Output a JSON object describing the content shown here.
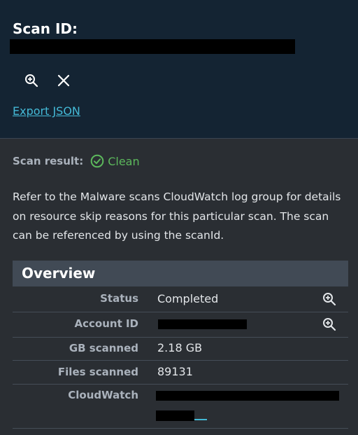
{
  "header": {
    "title": "Scan ID:",
    "export_label": "Export JSON",
    "zoom_icon": "zoom-in-icon",
    "close_icon": "close-icon"
  },
  "scan_result": {
    "label": "Scan result:",
    "value": "Clean",
    "icon": "check-circle-icon",
    "color": "#5cb85c"
  },
  "description": "Refer to the Malware scans CloudWatch log group for details on resource skip reasons for this particular scan. The scan can be referenced by using the scanId.",
  "overview": {
    "title": "Overview",
    "rows": [
      {
        "key": "Status",
        "value": "Completed"
      },
      {
        "key": "Account ID",
        "value": ""
      },
      {
        "key": "GB scanned",
        "value": "2.18 GB"
      },
      {
        "key": "Files scanned",
        "value": "89131"
      },
      {
        "key": "CloudWatch",
        "value": ""
      }
    ]
  },
  "colors": {
    "header_bg": "#142433",
    "panel_bg": "#2a2e33",
    "link": "#44b9d6",
    "section_header_bg": "#414a55"
  }
}
